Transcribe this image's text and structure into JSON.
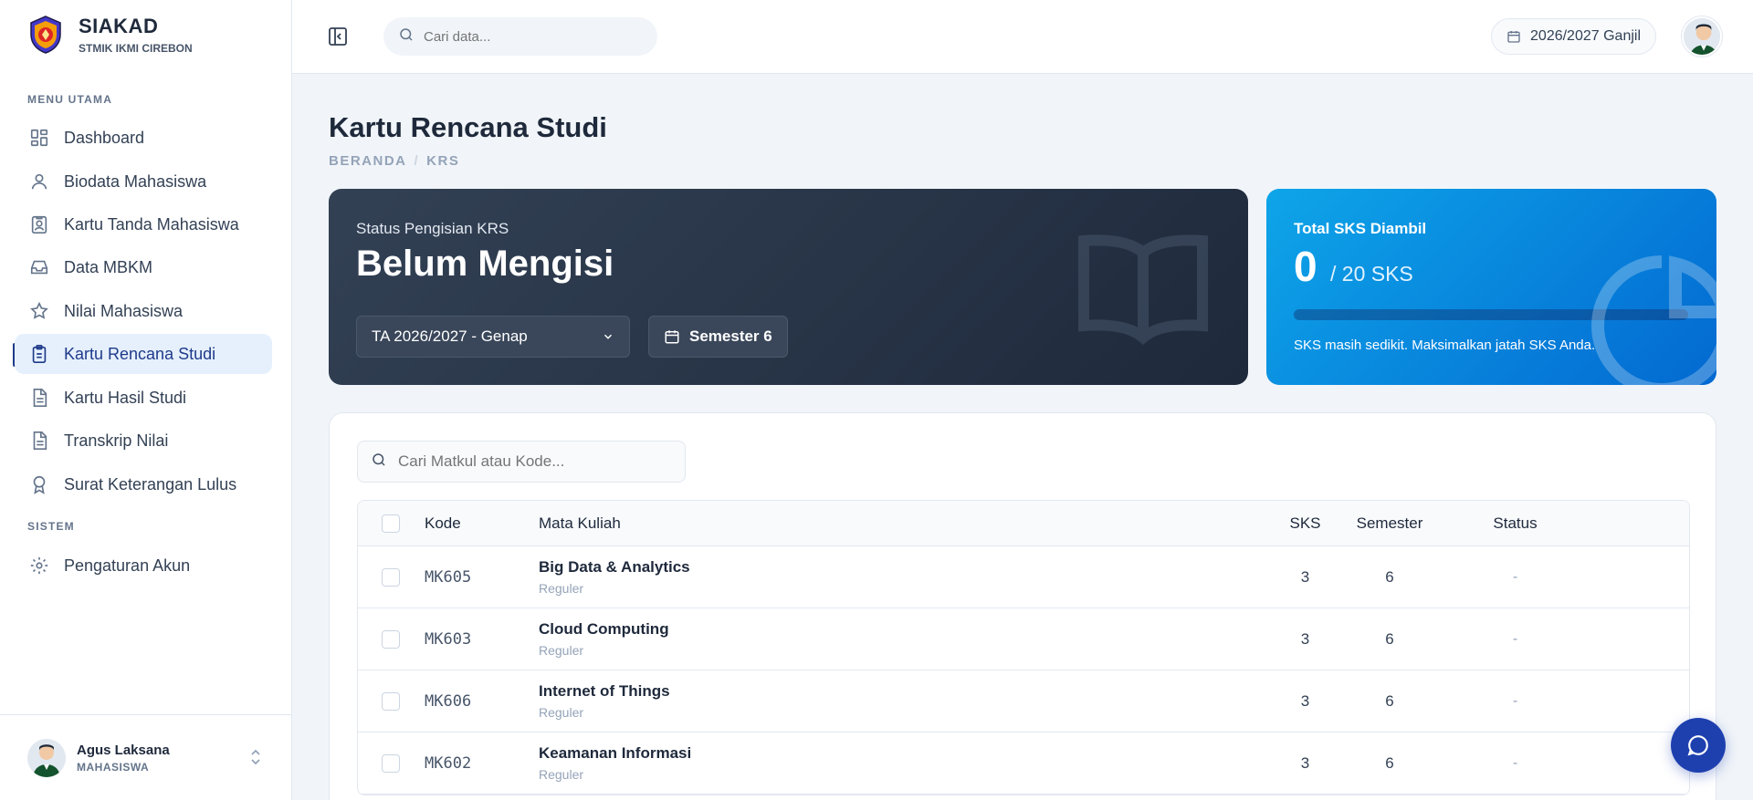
{
  "brand": {
    "title": "SIAKAD",
    "subtitle": "STMIK IKMI CIREBON"
  },
  "sidebar": {
    "main_section_label": "MENU UTAMA",
    "system_section_label": "SISTEM",
    "items": [
      {
        "label": "Dashboard",
        "icon": "dashboard-icon"
      },
      {
        "label": "Biodata Mahasiswa",
        "icon": "user-icon"
      },
      {
        "label": "Kartu Tanda Mahasiswa",
        "icon": "id-card-icon"
      },
      {
        "label": "Data MBKM",
        "icon": "inbox-icon"
      },
      {
        "label": "Nilai Mahasiswa",
        "icon": "star-icon"
      },
      {
        "label": "Kartu Rencana Studi",
        "icon": "clipboard-icon",
        "active": true
      },
      {
        "label": "Kartu Hasil Studi",
        "icon": "file-text-icon"
      },
      {
        "label": "Transkrip Nilai",
        "icon": "file-text-icon"
      },
      {
        "label": "Surat Keterangan Lulus",
        "icon": "award-icon"
      }
    ],
    "system_items": [
      {
        "label": "Pengaturan Akun",
        "icon": "gear-icon"
      }
    ],
    "user": {
      "name": "Agus Laksana",
      "role": "MAHASISWA"
    }
  },
  "topbar": {
    "search_placeholder": "Cari data...",
    "term": "2026/2027 Ganjil"
  },
  "page": {
    "title": "Kartu Rencana Studi",
    "breadcrumb": [
      "BERANDA",
      "KRS"
    ]
  },
  "status_card": {
    "label": "Status Pengisian KRS",
    "value": "Belum Mengisi",
    "ta_select": "TA 2026/2027 - Genap",
    "semester": "Semester 6"
  },
  "sks_card": {
    "label": "Total SKS Diambil",
    "value": "0",
    "total": "/ 20 SKS",
    "progress": 0,
    "note": "SKS masih sedikit. Maksimalkan jatah SKS Anda."
  },
  "table": {
    "search_placeholder": "Cari Matkul atau Kode...",
    "headers": {
      "kode": "Kode",
      "mk": "Mata Kuliah",
      "sks": "SKS",
      "semester": "Semester",
      "status": "Status"
    },
    "rows": [
      {
        "kode": "MK605",
        "name": "Big Data & Analytics",
        "type": "Reguler",
        "sks": "3",
        "semester": "6",
        "status": "-"
      },
      {
        "kode": "MK603",
        "name": "Cloud Computing",
        "type": "Reguler",
        "sks": "3",
        "semester": "6",
        "status": "-"
      },
      {
        "kode": "MK606",
        "name": "Internet of Things",
        "type": "Reguler",
        "sks": "3",
        "semester": "6",
        "status": "-"
      },
      {
        "kode": "MK602",
        "name": "Keamanan Informasi",
        "type": "Reguler",
        "sks": "3",
        "semester": "6",
        "status": "-"
      }
    ]
  },
  "colors": {
    "primary": "#1e3a8a",
    "dark_card": "#1e293b",
    "blue_card": "#0ea5e9"
  }
}
